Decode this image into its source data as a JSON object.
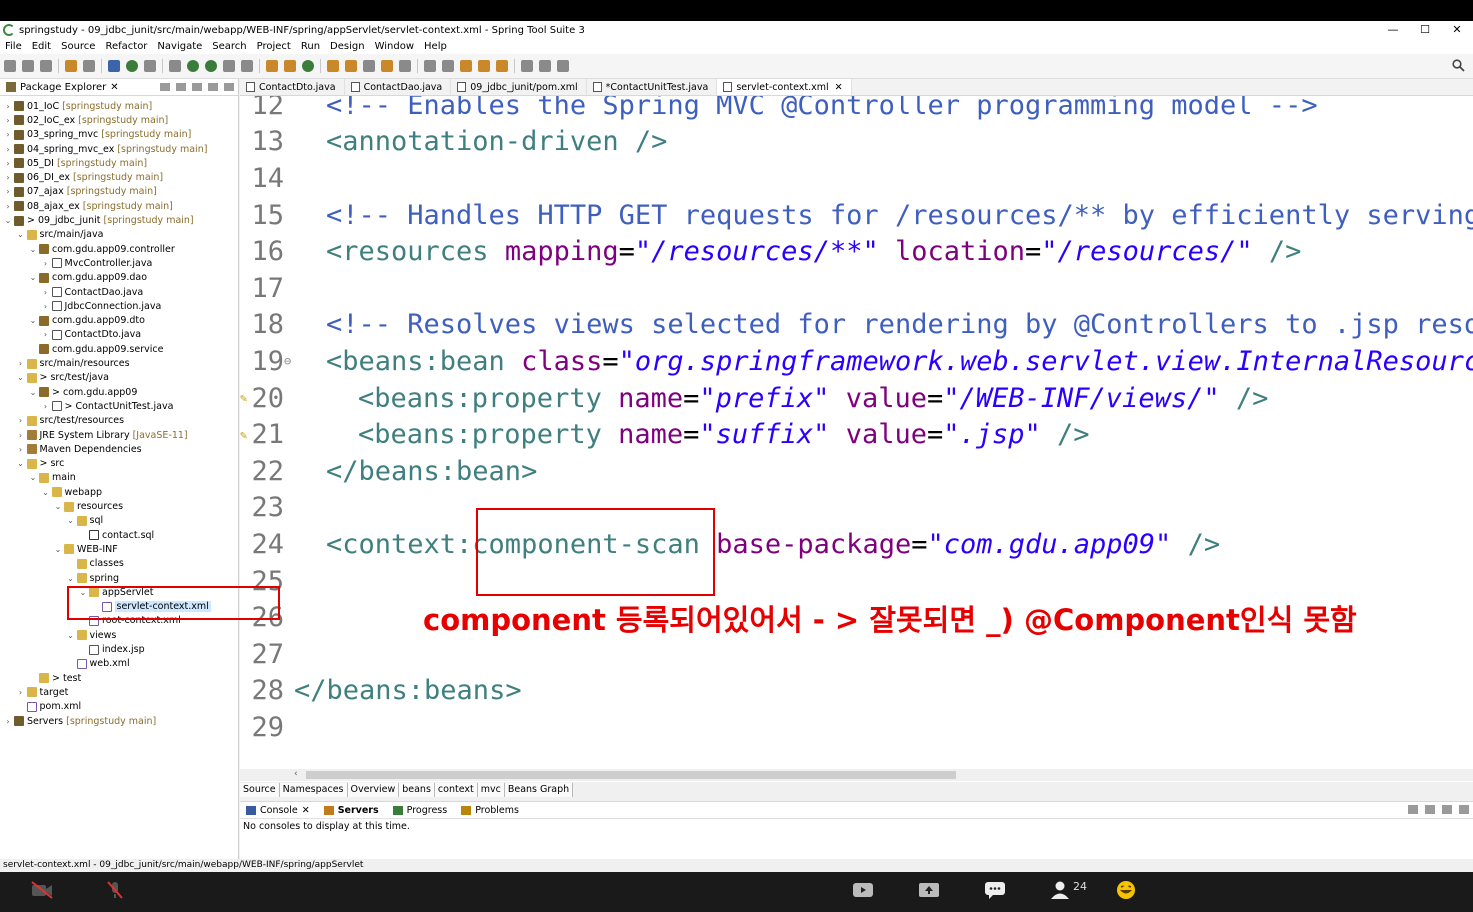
{
  "window": {
    "title": "springstudy - 09_jdbc_junit/src/main/webapp/WEB-INF/spring/appServlet/servlet-context.xml - Spring Tool Suite 3",
    "controls": [
      "—",
      "☐",
      "✕"
    ]
  },
  "menu": [
    "File",
    "Edit",
    "Source",
    "Refactor",
    "Navigate",
    "Search",
    "Project",
    "Run",
    "Design",
    "Window",
    "Help"
  ],
  "package_explorer": {
    "tab_label": "Package Explorer",
    "items": [
      {
        "label": "01_IoC",
        "decor": "[springstudy main]",
        "indent": 0,
        "twist": ">",
        "icon": "project"
      },
      {
        "label": "02_IoC_ex",
        "decor": "[springstudy main]",
        "indent": 0,
        "twist": ">",
        "icon": "project"
      },
      {
        "label": "03_spring_mvc",
        "decor": "[springstudy main]",
        "indent": 0,
        "twist": ">",
        "icon": "project"
      },
      {
        "label": "04_spring_mvc_ex",
        "decor": "[springstudy main]",
        "indent": 0,
        "twist": ">",
        "icon": "project"
      },
      {
        "label": "05_DI",
        "decor": "[springstudy main]",
        "indent": 0,
        "twist": ">",
        "icon": "project"
      },
      {
        "label": "06_DI_ex",
        "decor": "[springstudy main]",
        "indent": 0,
        "twist": ">",
        "icon": "project"
      },
      {
        "label": "07_ajax",
        "decor": "[springstudy main]",
        "indent": 0,
        "twist": ">",
        "icon": "project"
      },
      {
        "label": "08_ajax_ex",
        "decor": "[springstudy main]",
        "indent": 0,
        "twist": ">",
        "icon": "project"
      },
      {
        "label": "> 09_jdbc_junit",
        "decor": "[springstudy main]",
        "indent": 0,
        "twist": "v",
        "icon": "project"
      },
      {
        "label": "src/main/java",
        "decor": "",
        "indent": 1,
        "twist": "v",
        "icon": "folder"
      },
      {
        "label": "com.gdu.app09.controller",
        "decor": "",
        "indent": 2,
        "twist": "v",
        "icon": "package"
      },
      {
        "label": "MvcController.java",
        "decor": "",
        "indent": 3,
        "twist": ">",
        "icon": "java"
      },
      {
        "label": "com.gdu.app09.dao",
        "decor": "",
        "indent": 2,
        "twist": "v",
        "icon": "package"
      },
      {
        "label": "ContactDao.java",
        "decor": "",
        "indent": 3,
        "twist": ">",
        "icon": "java"
      },
      {
        "label": "JdbcConnection.java",
        "decor": "",
        "indent": 3,
        "twist": ">",
        "icon": "java"
      },
      {
        "label": "com.gdu.app09.dto",
        "decor": "",
        "indent": 2,
        "twist": "v",
        "icon": "package"
      },
      {
        "label": "ContactDto.java",
        "decor": "",
        "indent": 3,
        "twist": ">",
        "icon": "java"
      },
      {
        "label": "com.gdu.app09.service",
        "decor": "",
        "indent": 2,
        "twist": "",
        "icon": "package"
      },
      {
        "label": "src/main/resources",
        "decor": "",
        "indent": 1,
        "twist": ">",
        "icon": "folder"
      },
      {
        "label": "> src/test/java",
        "decor": "",
        "indent": 1,
        "twist": "v",
        "icon": "folder"
      },
      {
        "label": "> com.gdu.app09",
        "decor": "",
        "indent": 2,
        "twist": "v",
        "icon": "package"
      },
      {
        "label": "> ContactUnitTest.java",
        "decor": "",
        "indent": 3,
        "twist": ">",
        "icon": "java"
      },
      {
        "label": "src/test/resources",
        "decor": "",
        "indent": 1,
        "twist": ">",
        "icon": "folder"
      },
      {
        "label": "JRE System Library",
        "decor": "[JavaSE-11]",
        "indent": 1,
        "twist": ">",
        "icon": "lib"
      },
      {
        "label": "Maven Dependencies",
        "decor": "",
        "indent": 1,
        "twist": ">",
        "icon": "lib"
      },
      {
        "label": "> src",
        "decor": "",
        "indent": 1,
        "twist": "v",
        "icon": "folder"
      },
      {
        "label": "main",
        "decor": "",
        "indent": 2,
        "twist": "v",
        "icon": "folder"
      },
      {
        "label": "webapp",
        "decor": "",
        "indent": 3,
        "twist": "v",
        "icon": "folder"
      },
      {
        "label": "resources",
        "decor": "",
        "indent": 4,
        "twist": "v",
        "icon": "folder"
      },
      {
        "label": "sql",
        "decor": "",
        "indent": 5,
        "twist": "v",
        "icon": "folder"
      },
      {
        "label": "contact.sql",
        "decor": "",
        "indent": 6,
        "twist": "",
        "icon": "sql"
      },
      {
        "label": "WEB-INF",
        "decor": "",
        "indent": 4,
        "twist": "v",
        "icon": "folder"
      },
      {
        "label": "classes",
        "decor": "",
        "indent": 5,
        "twist": "",
        "icon": "folder"
      },
      {
        "label": "spring",
        "decor": "",
        "indent": 5,
        "twist": "v",
        "icon": "folder"
      },
      {
        "label": "appServlet",
        "decor": "",
        "indent": 6,
        "twist": "v",
        "icon": "folder"
      },
      {
        "label": "servlet-context.xml",
        "decor": "",
        "indent": 7,
        "twist": "",
        "icon": "xml",
        "selected": true
      },
      {
        "label": "root-context.xml",
        "decor": "",
        "indent": 6,
        "twist": "",
        "icon": "xml"
      },
      {
        "label": "views",
        "decor": "",
        "indent": 5,
        "twist": "v",
        "icon": "folder"
      },
      {
        "label": "index.jsp",
        "decor": "",
        "indent": 6,
        "twist": "",
        "icon": "java"
      },
      {
        "label": "web.xml",
        "decor": "",
        "indent": 5,
        "twist": "",
        "icon": "xml"
      },
      {
        "label": "> test",
        "decor": "",
        "indent": 2,
        "twist": "",
        "icon": "folder"
      },
      {
        "label": "target",
        "decor": "",
        "indent": 1,
        "twist": ">",
        "icon": "folder"
      },
      {
        "label": "pom.xml",
        "decor": "",
        "indent": 1,
        "twist": "",
        "icon": "xml"
      },
      {
        "label": "Servers",
        "decor": "[springstudy main]",
        "indent": 0,
        "twist": ">",
        "icon": "project"
      }
    ]
  },
  "editor": {
    "tabs": [
      {
        "label": "ContactDto.java",
        "active": false
      },
      {
        "label": "ContactDao.java",
        "active": false
      },
      {
        "label": "09_jdbc_junit/pom.xml",
        "active": false
      },
      {
        "label": "*ContactUnitTest.java",
        "active": false
      },
      {
        "label": "servlet-context.xml",
        "active": true
      }
    ],
    "lines": [
      {
        "num": "12",
        "segments": [
          [
            "c",
            "<!-- Enables the Spring MVC @Controller programming model -->"
          ]
        ],
        "indent": 1
      },
      {
        "num": "13",
        "segments": [
          [
            "t",
            "<annotation-driven />"
          ]
        ],
        "indent": 1
      },
      {
        "num": "14",
        "segments": [],
        "indent": 1
      },
      {
        "num": "15",
        "segments": [
          [
            "c",
            "<!-- Handles HTTP GET requests for /resources/** by efficiently serving up"
          ]
        ],
        "indent": 1
      },
      {
        "num": "16",
        "segments": [
          [
            "t",
            "<resources "
          ],
          [
            "a",
            "mapping"
          ],
          [
            "p",
            "="
          ],
          [
            "v",
            "\"/resources/**\""
          ],
          [
            "p",
            " "
          ],
          [
            "a",
            "location"
          ],
          [
            "p",
            "="
          ],
          [
            "v",
            "\"/resources/\""
          ],
          [
            "t",
            " />"
          ]
        ],
        "indent": 1
      },
      {
        "num": "17",
        "segments": [],
        "indent": 1
      },
      {
        "num": "18",
        "segments": [
          [
            "c",
            "<!-- Resolves views selected for rendering by @Controllers to .jsp resources"
          ]
        ],
        "indent": 1
      },
      {
        "num": "19",
        "segments": [
          [
            "t",
            "<beans:bean "
          ],
          [
            "a",
            "class"
          ],
          [
            "p",
            "="
          ],
          [
            "v",
            "\"org.springframework.web.servlet.view.InternalResourceViewResolver\""
          ]
        ],
        "indent": 1,
        "fold": true
      },
      {
        "num": "20",
        "segments": [
          [
            "t",
            "<beans:property "
          ],
          [
            "a",
            "name"
          ],
          [
            "p",
            "="
          ],
          [
            "v",
            "\"prefix\""
          ],
          [
            "p",
            " "
          ],
          [
            "a",
            "value"
          ],
          [
            "p",
            "="
          ],
          [
            "v",
            "\"/WEB-INF/views/\""
          ],
          [
            "t",
            " />"
          ]
        ],
        "indent": 2,
        "marker": true
      },
      {
        "num": "21",
        "segments": [
          [
            "t",
            "<beans:property "
          ],
          [
            "a",
            "name"
          ],
          [
            "p",
            "="
          ],
          [
            "v",
            "\"suffix\""
          ],
          [
            "p",
            " "
          ],
          [
            "a",
            "value"
          ],
          [
            "p",
            "="
          ],
          [
            "v",
            "\".jsp\""
          ],
          [
            "t",
            " />"
          ]
        ],
        "indent": 2,
        "marker": true
      },
      {
        "num": "22",
        "segments": [
          [
            "t",
            "</beans:bean>"
          ]
        ],
        "indent": 1
      },
      {
        "num": "23",
        "segments": [],
        "indent": 1
      },
      {
        "num": "24",
        "segments": [
          [
            "t",
            "<context:component-scan "
          ],
          [
            "a",
            "base-package"
          ],
          [
            "p",
            "="
          ],
          [
            "v",
            "\"com.gdu.app09\""
          ],
          [
            "t",
            " />"
          ]
        ],
        "indent": 1
      },
      {
        "num": "25",
        "segments": [],
        "indent": 1
      },
      {
        "num": "26",
        "segments": [],
        "indent": 1
      },
      {
        "num": "27",
        "segments": [],
        "indent": 1
      },
      {
        "num": "28",
        "segments": [
          [
            "t",
            "</beans:beans>"
          ]
        ],
        "indent": 0
      },
      {
        "num": "29",
        "segments": [],
        "indent": 0
      }
    ],
    "annotation": "component 등록되어있어서 - > 잘못되면 _) @Component인식 못함"
  },
  "design_tabs": [
    "Source",
    "Namespaces",
    "Overview",
    "beans",
    "context",
    "mvc",
    "Beans Graph"
  ],
  "console": {
    "tabs": [
      {
        "label": "Console",
        "bold": false,
        "close": true
      },
      {
        "label": "Servers",
        "bold": true,
        "close": false
      },
      {
        "label": "Progress",
        "bold": false,
        "close": false
      },
      {
        "label": "Problems",
        "bold": false,
        "close": false
      }
    ],
    "message": "No consoles to display at this time."
  },
  "statusbar": {
    "text": "servlet-context.xml - 09_jdbc_junit/src/main/webapp/WEB-INF/spring/appServlet"
  },
  "zoom_bar": {
    "participant_count": "24"
  }
}
